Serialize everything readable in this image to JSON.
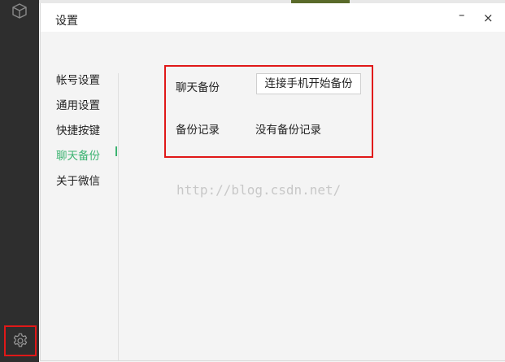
{
  "window": {
    "title": "设置",
    "minimize_label": "–",
    "close_label": "×"
  },
  "sidebar": {
    "top_icon": "cube-icon",
    "bottom_icon": "gear-icon"
  },
  "nav": {
    "items": [
      {
        "label": "帐号设置"
      },
      {
        "label": "通用设置"
      },
      {
        "label": "快捷按键"
      },
      {
        "label": "聊天备份",
        "active": true
      },
      {
        "label": "关于微信"
      }
    ]
  },
  "chat_backup": {
    "backup_label": "聊天备份",
    "backup_button": "连接手机开始备份",
    "record_label": "备份记录",
    "record_value": "没有备份记录"
  },
  "watermark": "http://blog.csdn.net/",
  "colors": {
    "sidebar_bg": "#2e2e2e",
    "active_green": "#3cb371",
    "highlight_red": "#e01818"
  }
}
